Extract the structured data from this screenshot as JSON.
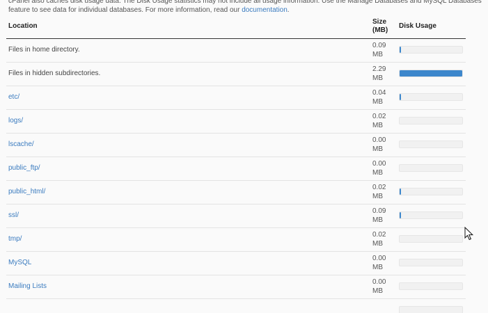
{
  "intro": {
    "line1": "cPanel also caches disk usage data. The Disk Usage statistics may not include all usage information. Use the Manage Databases and MySQL Databases",
    "line2_text": "feature to see data for individual databases. For more information, read our ",
    "line2_link": "documentation",
    "line2_end": "."
  },
  "table": {
    "headers": {
      "location": "Location",
      "size_line1": "Size",
      "size_line2": "(MB)",
      "usage": "Disk Usage"
    },
    "rows": [
      {
        "location": "Files in home directory.",
        "is_link": false,
        "size": "0.09",
        "unit": "MB",
        "usage": 0.02
      },
      {
        "location": "Files in hidden subdirectories.",
        "is_link": false,
        "size": "2.29",
        "unit": "MB",
        "usage": 1.0
      },
      {
        "location": "etc/",
        "is_link": true,
        "size": "0.04",
        "unit": "MB",
        "usage": 0.02
      },
      {
        "location": "logs/",
        "is_link": true,
        "size": "0.02",
        "unit": "MB",
        "usage": 0.0
      },
      {
        "location": "lscache/",
        "is_link": true,
        "size": "0.00",
        "unit": "MB",
        "usage": 0.0
      },
      {
        "location": "public_ftp/",
        "is_link": true,
        "size": "0.00",
        "unit": "MB",
        "usage": 0.0
      },
      {
        "location": "public_html/",
        "is_link": true,
        "size": "0.02",
        "unit": "MB",
        "usage": 0.02
      },
      {
        "location": "ssl/",
        "is_link": true,
        "size": "0.09",
        "unit": "MB",
        "usage": 0.02
      },
      {
        "location": "tmp/",
        "is_link": true,
        "size": "0.02",
        "unit": "MB",
        "usage": 0.0
      },
      {
        "location": "MySQL",
        "is_link": true,
        "size": "0.00",
        "unit": "MB",
        "usage": 0.0
      },
      {
        "location": "Mailing Lists",
        "is_link": true,
        "size": "0.00",
        "unit": "MB",
        "usage": 0.0
      }
    ],
    "partial_row_usage": 0.0
  },
  "colors": {
    "accent": "#3d87cc",
    "link": "#3a7bbf",
    "bar_bg": "#f1f1f1"
  },
  "icons": {
    "cursor": "mouse-pointer-icon"
  }
}
